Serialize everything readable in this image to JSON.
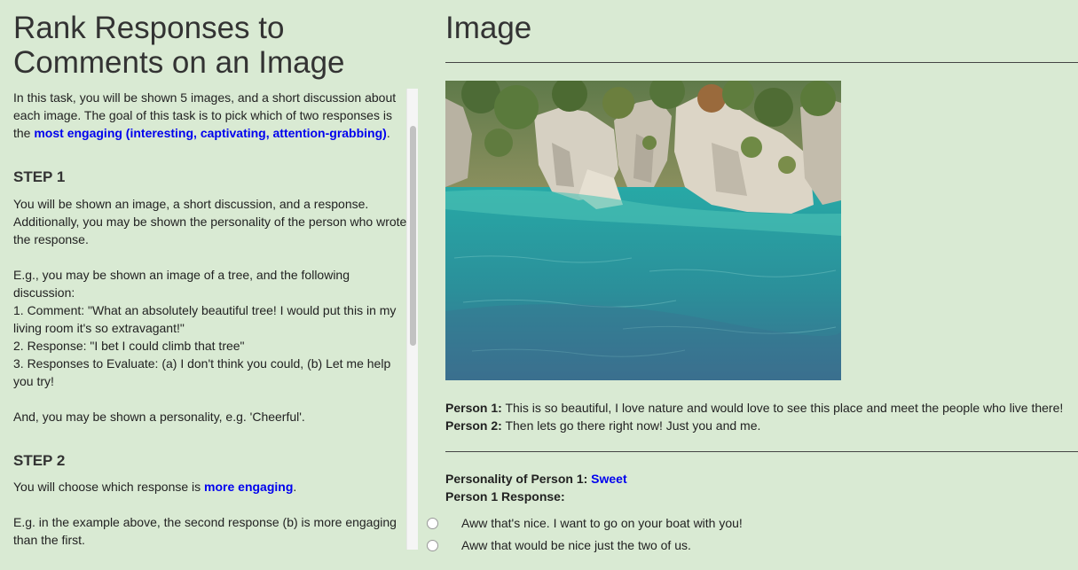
{
  "left": {
    "title_line1": "Rank Responses to",
    "title_line2": "Comments on an Image",
    "intro_text": "In this task, you will be shown 5 images, and a short discussion about each image. The goal of this task is to pick which of two responses is the ",
    "intro_link": "most engaging (interesting, captivating, attention-grabbing)",
    "intro_end": ".",
    "step1_heading": "STEP 1",
    "step1_p1": "You will be shown an image, a short discussion, and a response. Additionally, you may be shown the personality of the person who wrote the response.",
    "step1_p2": "E.g., you may be shown an image of a tree, and the following discussion:",
    "step1_l1": "1. Comment: \"What an absolutely beautiful tree! I would put this in my living room it's so extravagant!\"",
    "step1_l2": "2. Response: \"I bet I could climb that tree\"",
    "step1_l3": "3. Responses to Evaluate: (a) I don't think you could, (b) Let me help you try!",
    "step1_p3": "And, you may be shown a personality, e.g. 'Cheerful'.",
    "step2_heading": "STEP 2",
    "step2_text": "You will choose which response is ",
    "step2_link": "more engaging",
    "step2_end": ".",
    "step2_example": "E.g. in the example above, the second response (b) is more engaging than the first."
  },
  "right": {
    "title": "Image",
    "person1_label": "Person 1:",
    "person1_text": " This is so beautiful, I love nature and would love to see this place and meet the people who live there!",
    "person2_label": "Person 2:",
    "person2_text": " Then lets go there right now! Just you and me.",
    "personality_label": "Personality of Person 1: ",
    "personality_value": "Sweet",
    "response_label": "Person 1 Response:",
    "options": [
      "Aww that's nice. I want to go on your boat with you!",
      "Aww that would be nice just the two of us."
    ]
  },
  "colors": {
    "background": "#d9ead3",
    "link": "#0000ee"
  }
}
